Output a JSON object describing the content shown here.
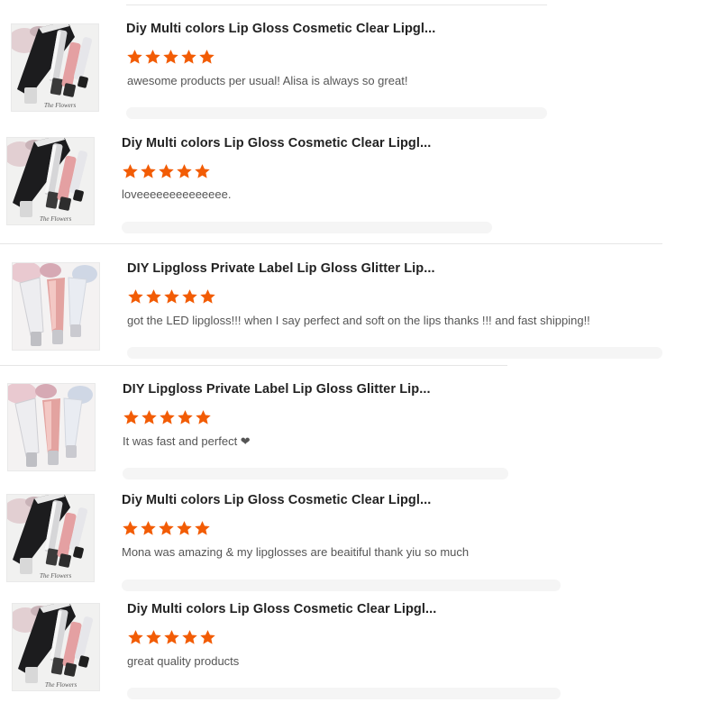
{
  "colors": {
    "star": "#f25c05",
    "divider": "#e6e6e6",
    "reply_bar": "#f5f5f5"
  },
  "reviews": [
    {
      "product_title": "Diy Multi colors Lip Gloss Cosmetic Clear Lipgl...",
      "rating": 5,
      "text": "awesome products per usual! Alisa is always so great!",
      "thumb_variant": "black-tube",
      "watermark": "The Flowers"
    },
    {
      "product_title": "Diy Multi colors Lip Gloss Cosmetic Clear Lipgl...",
      "rating": 5,
      "text": "loveeeeeeeeeeeeee.",
      "thumb_variant": "black-tube",
      "watermark": "The Flowers"
    },
    {
      "product_title": "DIY Lipgloss Private Label Lip Gloss Glitter Lip...",
      "rating": 5,
      "text": "got the LED lipgloss!!! when I say perfect and soft on the lips thanks !!! and fast shipping!!",
      "thumb_variant": "squeeze-tube",
      "watermark": ""
    },
    {
      "product_title": "DIY Lipgloss Private Label Lip Gloss Glitter Lip...",
      "rating": 5,
      "text": "It was fast and perfect ❤",
      "thumb_variant": "squeeze-tube",
      "watermark": ""
    },
    {
      "product_title": "Diy Multi colors Lip Gloss Cosmetic Clear Lipgl...",
      "rating": 5,
      "text": "Mona was amazing & my lipglosses are beaitiful thank yiu so much",
      "thumb_variant": "black-tube",
      "watermark": "The Flowers"
    },
    {
      "product_title": "Diy Multi colors Lip Gloss Cosmetic Clear Lipgl...",
      "rating": 5,
      "text": "great quality products",
      "thumb_variant": "black-tube",
      "watermark": "The Flowers"
    }
  ]
}
